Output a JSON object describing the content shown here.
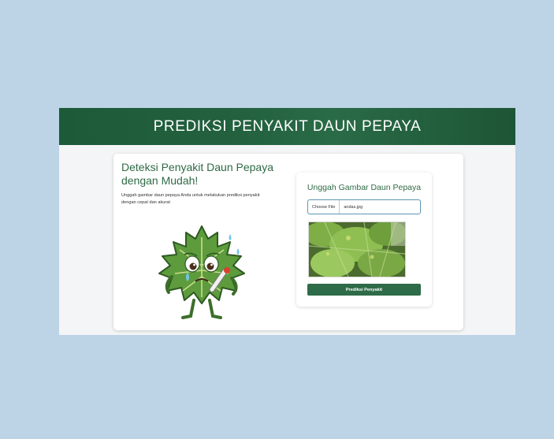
{
  "header": {
    "title": "PREDIKSI PENYAKIT DAUN PEPAYA"
  },
  "intro": {
    "title": "Deteksi Penyakit Daun Pepaya dengan Mudah!",
    "description": "Unggah gambar daun pepaya Anda untuk melakukan prediksi penyakit dengan cepat dan akurat"
  },
  "upload": {
    "title": "Unggah Gambar Daun Pepaya",
    "choose_file_label": "Choose File",
    "file_name": "andas.jpg",
    "submit_label": "Prediksi Penyakit"
  },
  "colors": {
    "brand_green": "#2e6b48",
    "header_green": "#1f5c3a",
    "page_background": "#bdd3e6",
    "input_border": "#5b97b8"
  },
  "icons": [
    "papaya-leaf-mascot-illustration"
  ]
}
